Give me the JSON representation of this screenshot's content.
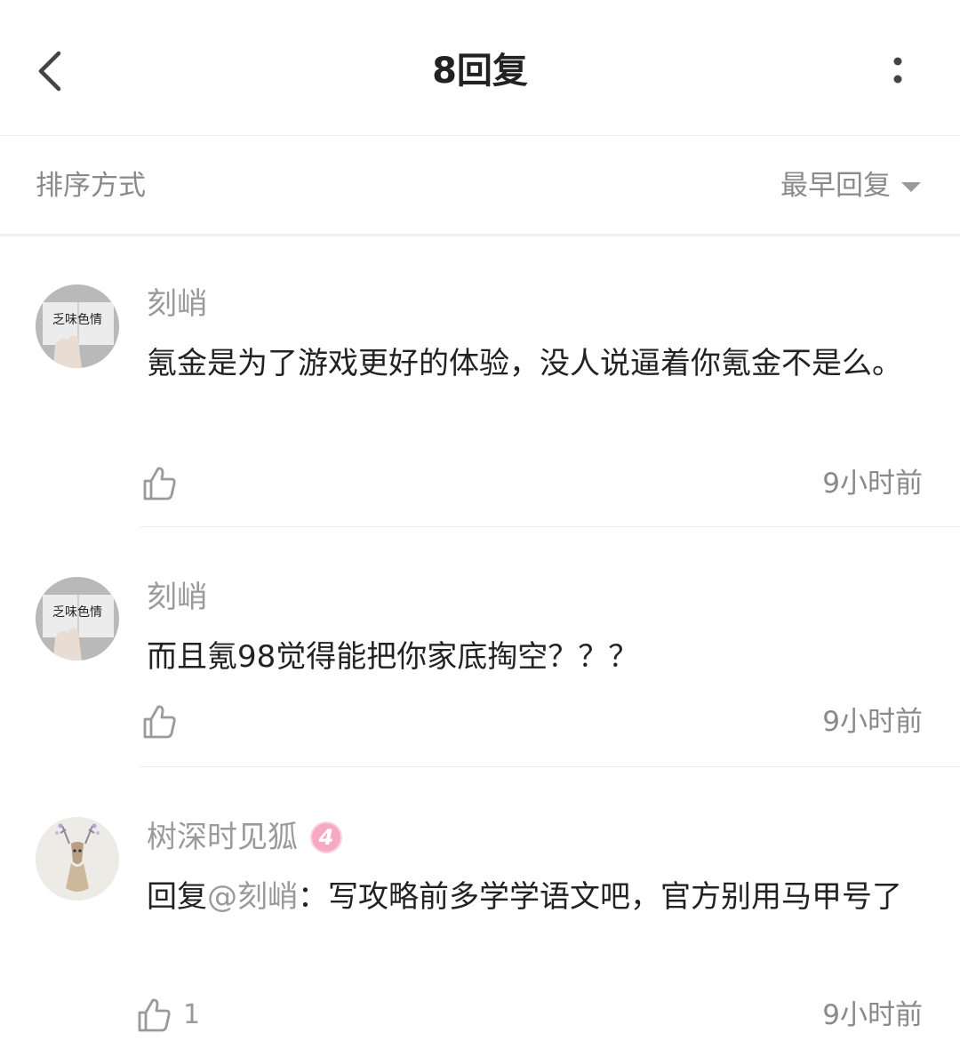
{
  "header": {
    "title": "8回复"
  },
  "sort": {
    "label": "排序方式",
    "value": "最早回复"
  },
  "comments": [
    {
      "username": "刻峭",
      "avatar_text": "乏味色情",
      "content": "氪金是为了游戏更好的体验，没人说逼着你氪金不是么。",
      "time": "9小时前"
    },
    {
      "username": "刻峭",
      "avatar_text": "乏味色情",
      "content": "而且氪98觉得能把你家底掏空？？？",
      "time": "9小时前"
    },
    {
      "username": "树深时见狐",
      "level": "4",
      "reply_prefix": "回复",
      "mention": "@刻峭",
      "content": "：写攻略前多学学语文吧，官方别用马甲号了",
      "likes": "1",
      "time": "9小时前"
    }
  ],
  "icons": [
    "back-arrow-icon",
    "more-vertical-icon",
    "caret-down-icon",
    "thumbs-up-icon"
  ],
  "colors": {
    "text": "#222222",
    "muted": "#9a9a9a",
    "badge": "#f7a9c3"
  }
}
